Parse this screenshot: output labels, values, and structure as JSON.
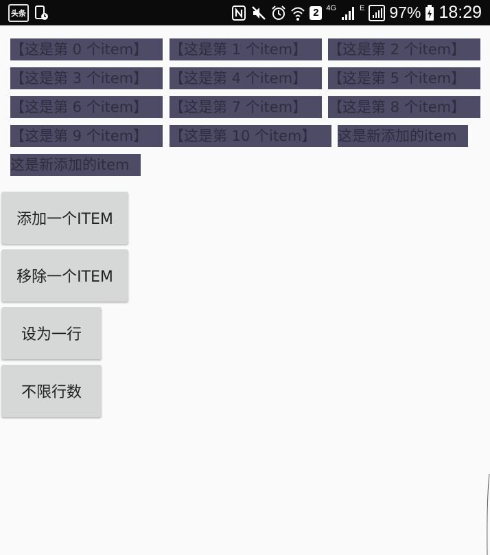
{
  "status_bar": {
    "app_badge": "头条",
    "sim_number": "2",
    "network_4g": "4G",
    "network_e": "E",
    "battery": "97%",
    "time": "18:29",
    "icons": [
      "toutiao-app-icon",
      "screenshot-icon",
      "nfc-icon",
      "mute-icon",
      "alarm-icon",
      "wifi-icon",
      "sim2-icon",
      "signal-icon",
      "signal-icon-2",
      "battery-icon"
    ]
  },
  "tags": [
    "【这是第 0 个item】",
    "【这是第 1 个item】",
    "【这是第 2 个item】",
    "【这是第 3 个item】",
    "【这是第 4 个item】",
    "【这是第 5 个item】",
    "【这是第 6 个item】",
    "【这是第 7 个item】",
    "【这是第 8 个item】",
    "【这是第 9 个item】",
    "【这是第 10 个item】",
    "这是新添加的item",
    "这是新添加的item"
  ],
  "buttons": {
    "add": "添加一个ITEM",
    "remove": "移除一个ITEM",
    "single_line": "设为一行",
    "unlimited": "不限行数"
  },
  "colors": {
    "tag_background": "#4e4b67",
    "tag_text": "#2d2d3d",
    "button_background": "#d6d7d7",
    "page_background": "#fafafa",
    "status_bar": "#0b0b0b"
  }
}
